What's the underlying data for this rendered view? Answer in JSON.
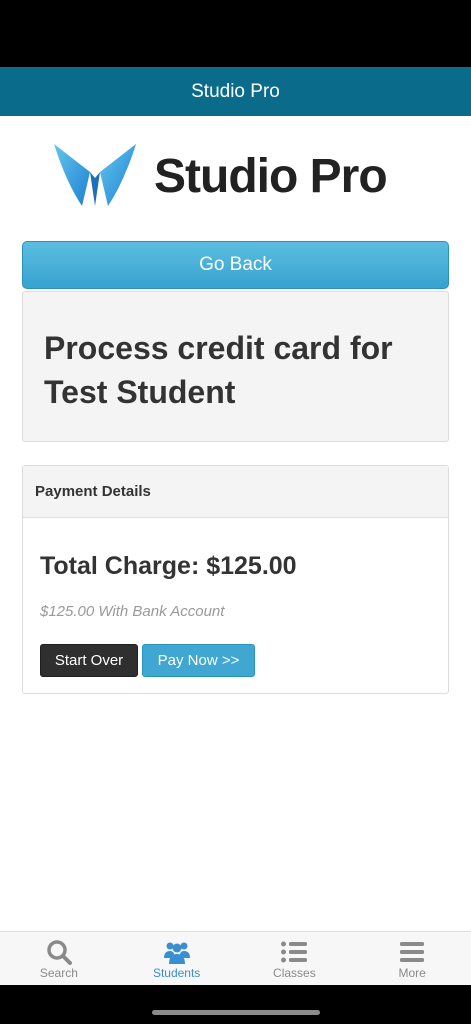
{
  "app_header": {
    "title": "Studio Pro"
  },
  "logo": {
    "text": "Studio Pro",
    "colors": {
      "mark": "#3a9fdb",
      "text": "#222222"
    }
  },
  "go_back_label": "Go Back",
  "title_card": {
    "heading": "Process credit card for Test Student"
  },
  "payment": {
    "header": "Payment Details",
    "total_charge": "Total Charge: $125.00",
    "note": "$125.00 With Bank Account",
    "start_over_label": "Start Over",
    "pay_now_label": "Pay Now >>"
  },
  "tabs": [
    {
      "label": "Search",
      "icon": "search-icon",
      "active": false
    },
    {
      "label": "Students",
      "icon": "users-icon",
      "active": true
    },
    {
      "label": "Classes",
      "icon": "list-icon",
      "active": false
    },
    {
      "label": "More",
      "icon": "menu-icon",
      "active": false
    }
  ],
  "colors": {
    "header_bg": "#0a6b8a",
    "accent": "#3fa7d1",
    "active_tab": "#3a8fd0"
  }
}
